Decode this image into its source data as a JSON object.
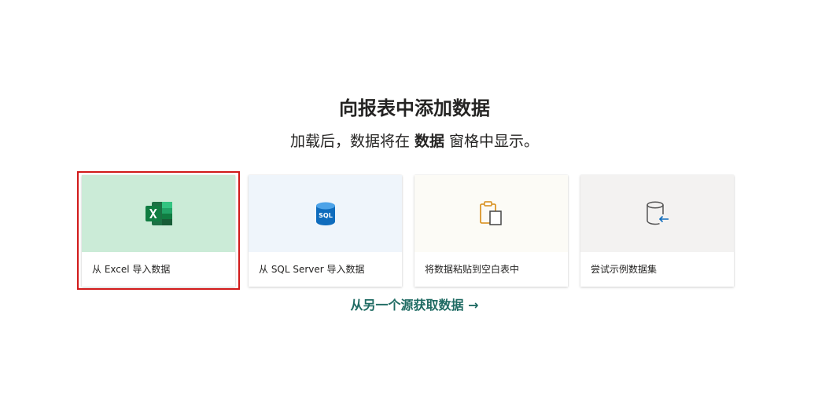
{
  "header": {
    "title": "向报表中添加数据",
    "subtitle_before": "加载后，数据将在 ",
    "subtitle_bold": "数据",
    "subtitle_after": " 窗格中显示。"
  },
  "cards": [
    {
      "label": "从 Excel 导入数据",
      "icon": "excel-icon",
      "bg": "#cbebd7"
    },
    {
      "label": "从 SQL Server 导入数据",
      "icon": "sql-database-icon",
      "bg": "#eff5fb"
    },
    {
      "label": "将数据粘贴到空白表中",
      "icon": "clipboard-paste-icon",
      "bg": "#fcfbf6"
    },
    {
      "label": "尝试示例数据集",
      "icon": "sample-dataset-icon",
      "bg": "#f3f2f1"
    }
  ],
  "link": {
    "label": "从另一个源获取数据 →",
    "color": "#1f6b63"
  },
  "highlight_color": "#d11a1a"
}
